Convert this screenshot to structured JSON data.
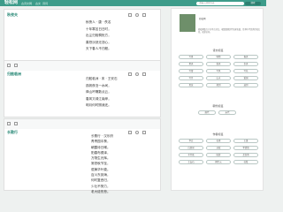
{
  "header": {
    "logo": "轻松网",
    "nav": [
      "古诗文网",
      "古文",
      "诗词"
    ],
    "search_placeholder": "请输入搜索内容",
    "search_button": "搜索"
  },
  "cards": [
    {
      "title": "秋夜夫",
      "lines": [
        "秋夜人 · 唐 · 佚名",
        "十年寒苦日日时，",
        "出尘归相惆怅方，",
        "喜怒淡然无怨心，",
        "天下春人不归程。"
      ]
    },
    {
      "title": "归舷临洲",
      "lines": [
        "归舷临洲 · 宋 · 王安石",
        "孤帆夜泊一水间，",
        "烽山吟隔数点云，",
        "春风又绿江南岸，",
        "明月何时照我还。"
      ]
    },
    {
      "title": "长歌行",
      "lines": [
        "长歌行 · 汉乐府",
        "青青园中葵，",
        "朝露待日晞。",
        "阳春布德泽，",
        "万物生光辉。",
        "常恐秋节至，",
        "焜黄华叶衰。",
        "百川东到海，",
        "何时复西归，",
        "少壮不努力，",
        "老大徒伤悲。"
      ]
    }
  ],
  "sidebar": {
    "profile_sub": "轻松网",
    "profile_desc": "轻松网致力于分享古诗文，收集整理历代名家名篇，传承中华优秀传统文化，欢迎访问。",
    "section1": "诗文标签",
    "tags1": [
      "写景",
      "咏物",
      "春天",
      "夏天",
      "秋天",
      "冬天",
      "写雪",
      "写风",
      "写花",
      "写月",
      "山水",
      "爱国",
      "思念",
      "离别",
      "送别"
    ],
    "section2": "朝代标签",
    "tags2": [
      "唐代",
      "宋代"
    ],
    "section3": "作者标签",
    "tags3": [
      "李白",
      "杜甫",
      "王维",
      "白居易",
      "苏轼",
      "李清照",
      "辛弃疾",
      "陆游",
      "孟浩然",
      "王安石",
      "柳宗元",
      "杜牧"
    ]
  }
}
